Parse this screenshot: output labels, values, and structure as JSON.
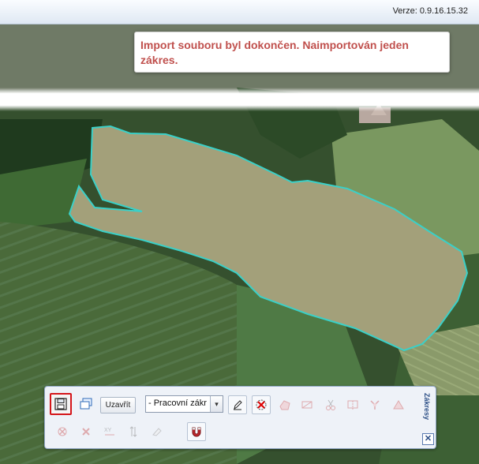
{
  "header": {
    "version_text": "Verze: 0.9.16.15.32"
  },
  "notification": {
    "message": "Import souboru byl dokončen. Naimportován jeden zákres."
  },
  "toolbar": {
    "close_label": "Uzavřít",
    "dropdown_value": "- Pracovní zákr",
    "dropdown_arrow": "▾",
    "side_tab_label": "Zákresy",
    "close_icon": "✕"
  },
  "colors": {
    "accent_red": "#d4161a",
    "parcel_outline": "#3ad0c8",
    "notification_text": "#c0504d"
  }
}
